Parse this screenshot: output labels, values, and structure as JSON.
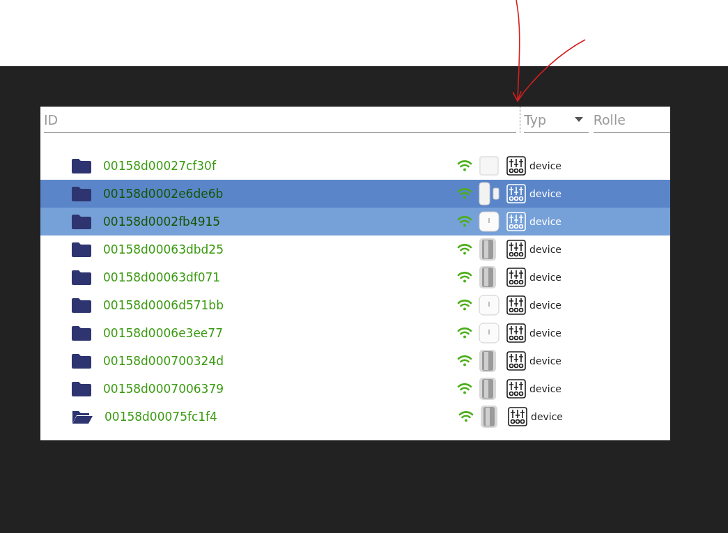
{
  "filters": {
    "id": {
      "placeholder": "ID"
    },
    "type": {
      "placeholder": "Typ"
    },
    "role": {
      "placeholder": "Rolle"
    }
  },
  "rows": [
    {
      "id": "00158d00027cf30f",
      "kind": "cube",
      "role": "device",
      "selected": false,
      "hovered": false,
      "expanded": false
    },
    {
      "id": "00158d0002e6de6b",
      "kind": "contact",
      "role": "device",
      "selected": true,
      "hovered": false,
      "expanded": false
    },
    {
      "id": "00158d0002fb4915",
      "kind": "temp",
      "role": "device",
      "selected": false,
      "hovered": true,
      "expanded": false
    },
    {
      "id": "00158d00063dbd25",
      "kind": "motion",
      "role": "device",
      "selected": false,
      "hovered": false,
      "expanded": false
    },
    {
      "id": "00158d00063df071",
      "kind": "motion",
      "role": "device",
      "selected": false,
      "hovered": false,
      "expanded": false
    },
    {
      "id": "00158d0006d571bb",
      "kind": "temp",
      "role": "device",
      "selected": false,
      "hovered": false,
      "expanded": false
    },
    {
      "id": "00158d0006e3ee77",
      "kind": "temp",
      "role": "device",
      "selected": false,
      "hovered": false,
      "expanded": false
    },
    {
      "id": "00158d000700324d",
      "kind": "motion",
      "role": "device",
      "selected": false,
      "hovered": false,
      "expanded": false
    },
    {
      "id": "00158d0007006379",
      "kind": "motion",
      "role": "device",
      "selected": false,
      "hovered": false,
      "expanded": false
    },
    {
      "id": "00158d00075fc1f4",
      "kind": "motion",
      "role": "device",
      "selected": false,
      "hovered": false,
      "expanded": true
    }
  ]
}
